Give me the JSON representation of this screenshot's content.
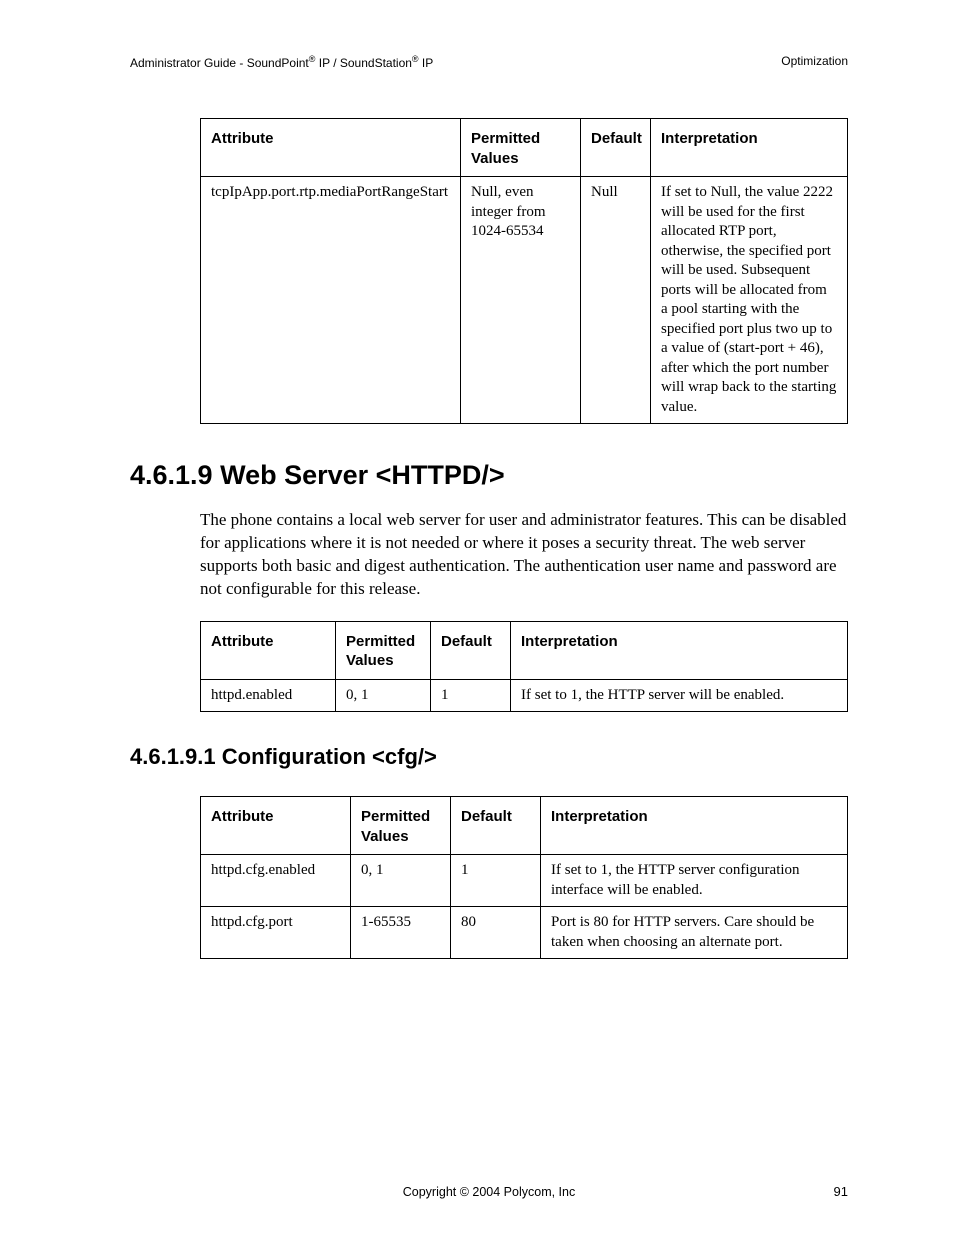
{
  "header": {
    "left_prefix": "Administrator Guide - SoundPoint",
    "reg": "®",
    "left_mid": " IP / SoundStation",
    "left_suffix": " IP",
    "right": "Optimization"
  },
  "table1": {
    "headers": [
      "Attribute",
      "Permitted Values",
      "Default",
      "Interpretation"
    ],
    "rows": [
      {
        "attribute": "tcpIpApp.port.rtp.mediaPortRangeStart",
        "permitted": "Null, even integer from 1024-65534",
        "default": "Null",
        "interpretation": "If set to Null, the value 2222 will be used for the first allocated RTP port, otherwise, the specified port will be used.  Subsequent ports will be allocated from a pool starting with the specified port plus two up to a value of (start-port + 46), after which the port number will wrap back to the starting value."
      }
    ]
  },
  "section1": {
    "heading": "4.6.1.9  Web Server <HTTPD/>",
    "paragraph": "The phone contains a local web server for user and administrator features.  This can be disabled for applications where it is not needed or where it poses a security threat.  The web server supports both basic and digest authentication.  The authentication user name and password are not configurable for this release."
  },
  "table2": {
    "headers": [
      "Attribute",
      "Permitted Values",
      "Default",
      "Interpretation"
    ],
    "rows": [
      {
        "attribute": "httpd.enabled",
        "permitted": "0, 1",
        "default": "1",
        "interpretation": "If set to 1, the HTTP server will be enabled."
      }
    ]
  },
  "section2": {
    "heading": "4.6.1.9.1  Configuration <cfg/>"
  },
  "table3": {
    "headers": [
      "Attribute",
      "Permitted Values",
      "Default",
      "Interpretation"
    ],
    "rows": [
      {
        "attribute": "httpd.cfg.enabled",
        "permitted": "0, 1",
        "default": "1",
        "interpretation": "If set to 1, the HTTP server configuration interface will be enabled."
      },
      {
        "attribute": "httpd.cfg.port",
        "permitted": "1-65535",
        "default": "80",
        "interpretation": "Port is 80 for HTTP servers.  Care should be taken when choosing an alternate port."
      }
    ]
  },
  "footer": {
    "copyright": "Copyright © 2004 Polycom, Inc",
    "page": "91"
  }
}
